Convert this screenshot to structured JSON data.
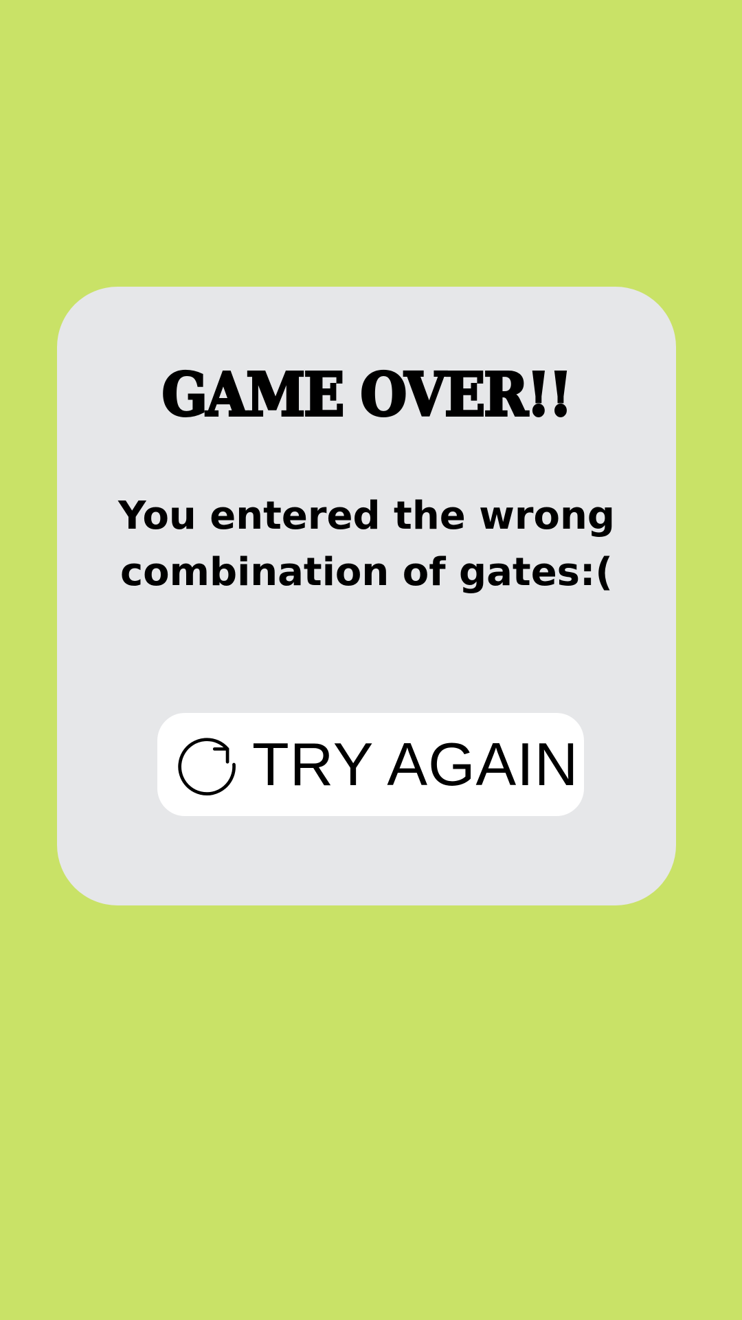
{
  "screen": {
    "background_color": "#c9e267"
  },
  "dialog": {
    "background_color": "#e6e7e9",
    "title": "GAME OVER!!",
    "message": "You entered the wrong combination of gates:(",
    "button": {
      "icon": "refresh-icon",
      "label": "TRY AGAIN",
      "background_color": "#ffffff"
    }
  }
}
